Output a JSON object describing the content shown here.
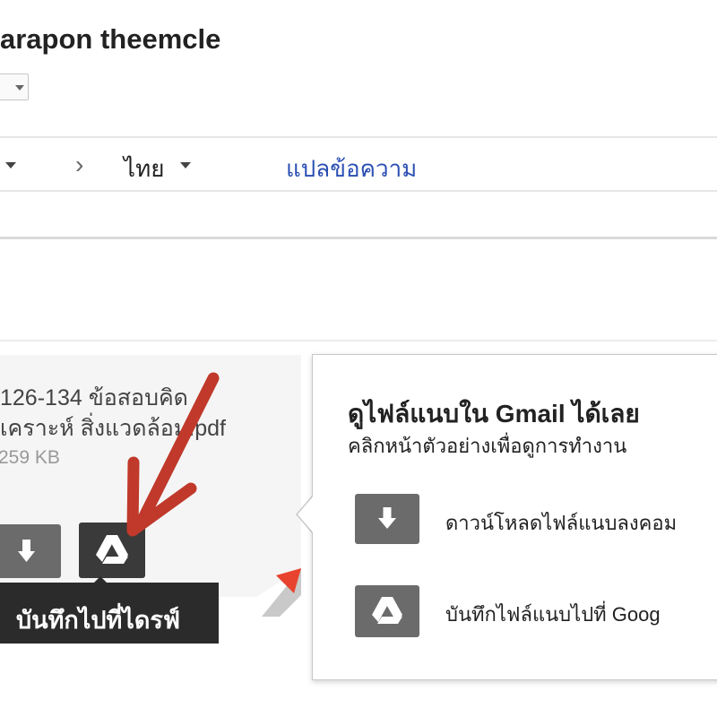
{
  "header": {
    "sender_name": "arapon theemcle"
  },
  "translate_bar": {
    "target_language": "ไทย",
    "translate_link": "แปลข้อความ"
  },
  "attachment": {
    "filename_line1": "126-134 ข้อสอบคิด",
    "filename_line2": "เคราะห์ สิ่งแวดล้อม.pdf",
    "size": "259 KB",
    "download_icon": "download-icon",
    "drive_icon": "drive-icon",
    "tooltip": "บันทึกไปที่ไดรฟ์"
  },
  "promo": {
    "title": "ดูไฟล์แนบใน Gmail ได้เลย",
    "subtitle": "คลิกหน้าตัวอย่างเพื่อดูการทำงาน",
    "download_text": "ดาวน์โหลดไฟล์แนบลงคอม",
    "drive_text": "บันทึกไฟล์แนบไปที่ Goog"
  },
  "colors": {
    "annotation_arrow": "#c0392b",
    "link": "#2b4fb3",
    "fold_corner": "#e8432e"
  }
}
